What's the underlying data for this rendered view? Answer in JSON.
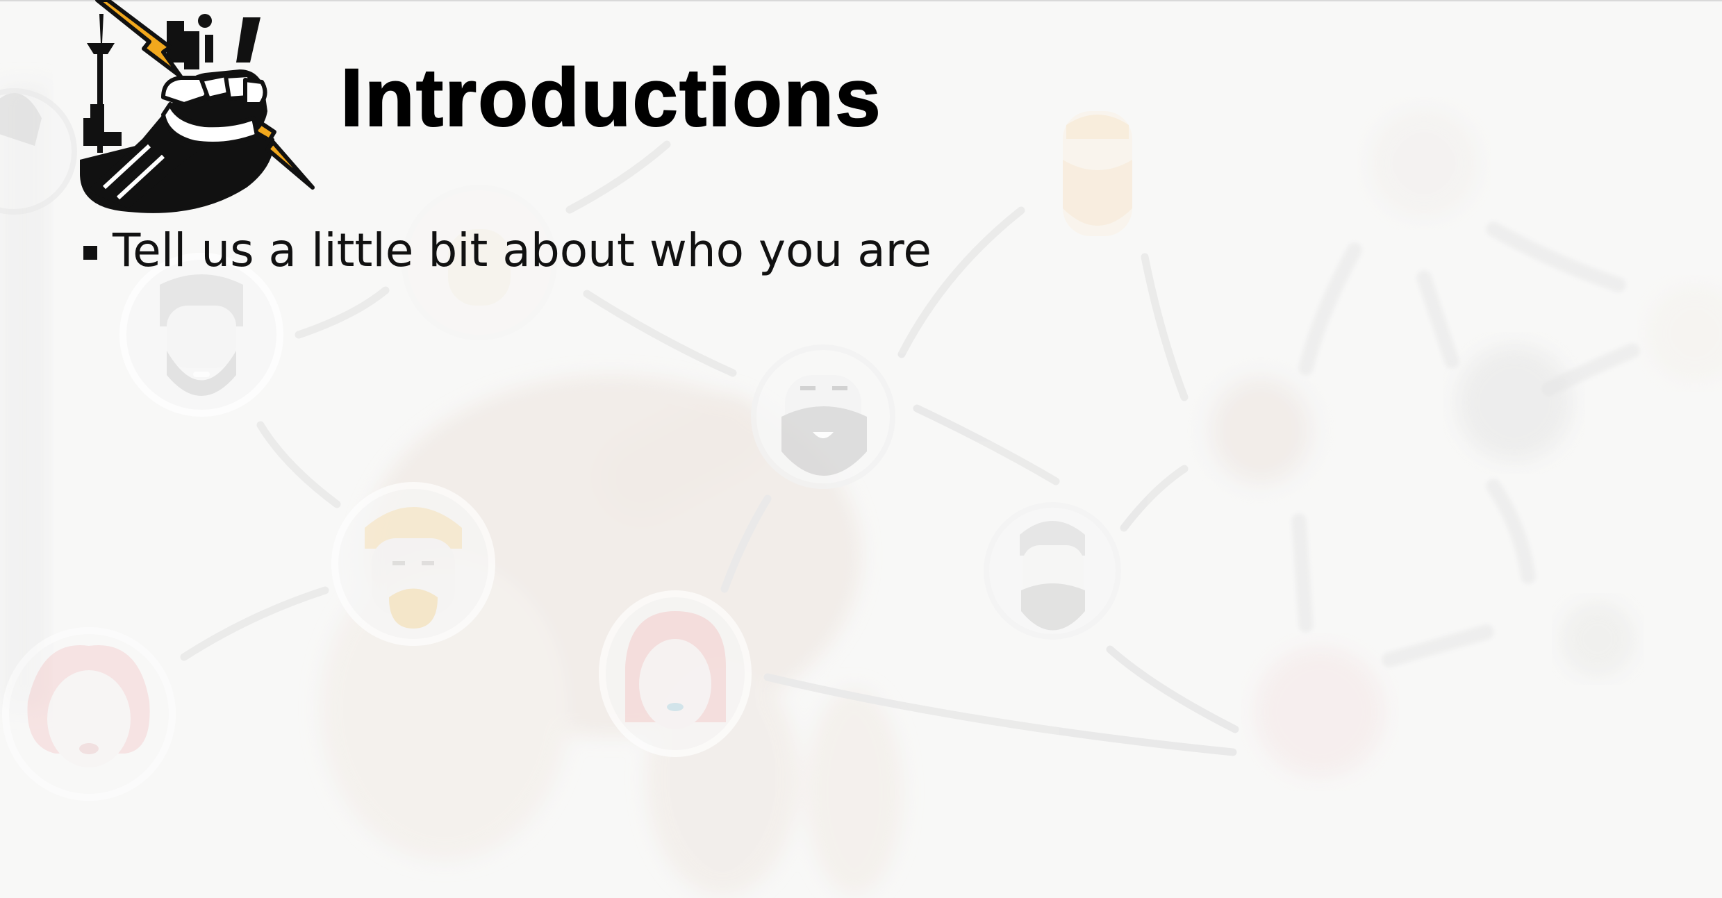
{
  "slide": {
    "title": "Introductions",
    "bullets": [
      "Tell us a little bit about who you are"
    ]
  },
  "colors": {
    "background": "#f7f7f6",
    "title": "#000000",
    "logo_accent": "#f2a81d",
    "logo_dark": "#111111"
  },
  "icons": {
    "logo": "fist-lightning-city-skyline-logo",
    "background": "faded-people-network-illustration"
  }
}
